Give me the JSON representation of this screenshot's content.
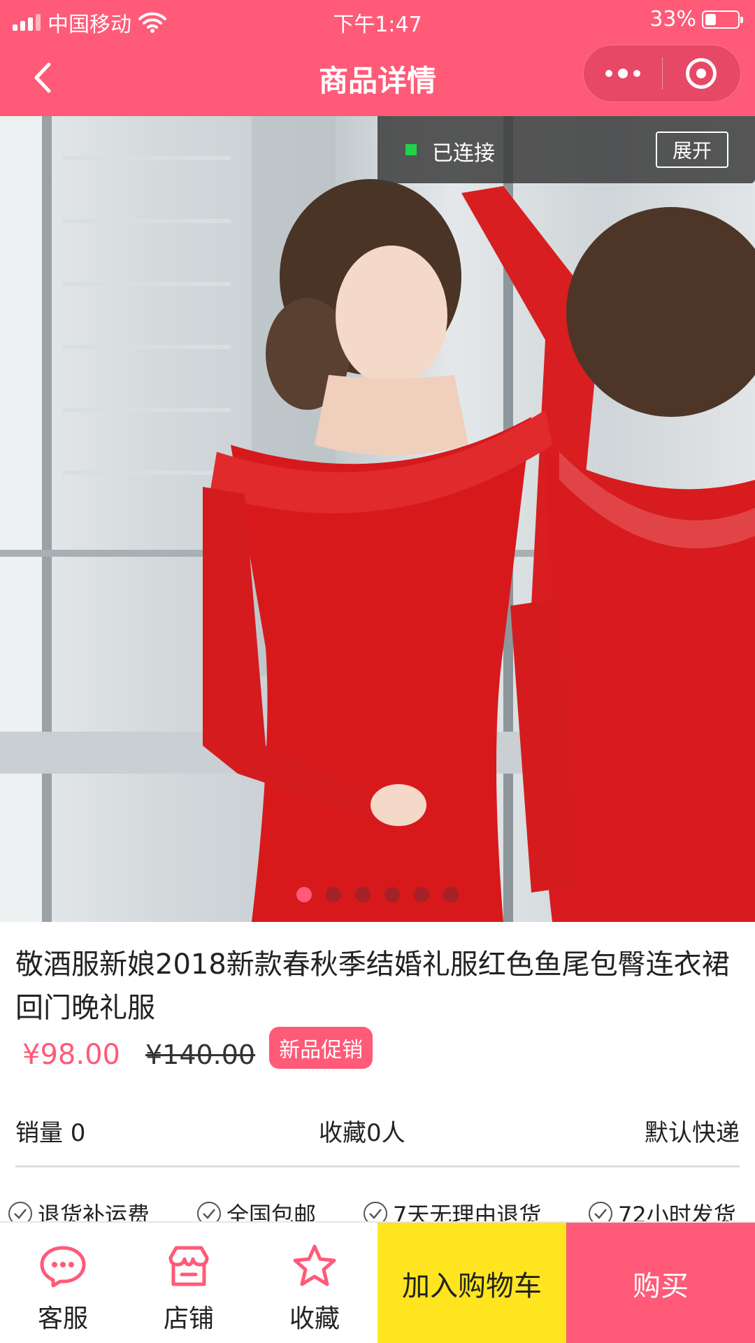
{
  "status_bar": {
    "carrier": "中国移动",
    "time": "下午1:47",
    "battery": "33%",
    "battery_level": 0.33
  },
  "nav": {
    "title": "商品详情"
  },
  "connection": {
    "status": "已连接",
    "expand_label": "展开"
  },
  "carousel": {
    "image_count": 6,
    "active_index": 0
  },
  "product": {
    "title": "敬酒服新娘2018新款春秋季结婚礼服红色鱼尾包臀连衣裙回门晚礼服",
    "price": "¥98.00",
    "original_price": "¥140.00",
    "promo_badge": "新品促销",
    "sales": "销量 0",
    "favorites": "收藏0人",
    "shipping": "默认快递"
  },
  "services": [
    "退货补运费",
    "全国包邮",
    "7天无理由退货",
    "72小时发货"
  ],
  "bottom_bar": {
    "customer_service": "客服",
    "store": "店铺",
    "favorite": "收藏",
    "add_to_cart": "加入购物车",
    "buy": "购买"
  },
  "colors": {
    "brand": "#ff5a78",
    "cart_button": "#ffe51f",
    "connected": "#22d34a"
  }
}
